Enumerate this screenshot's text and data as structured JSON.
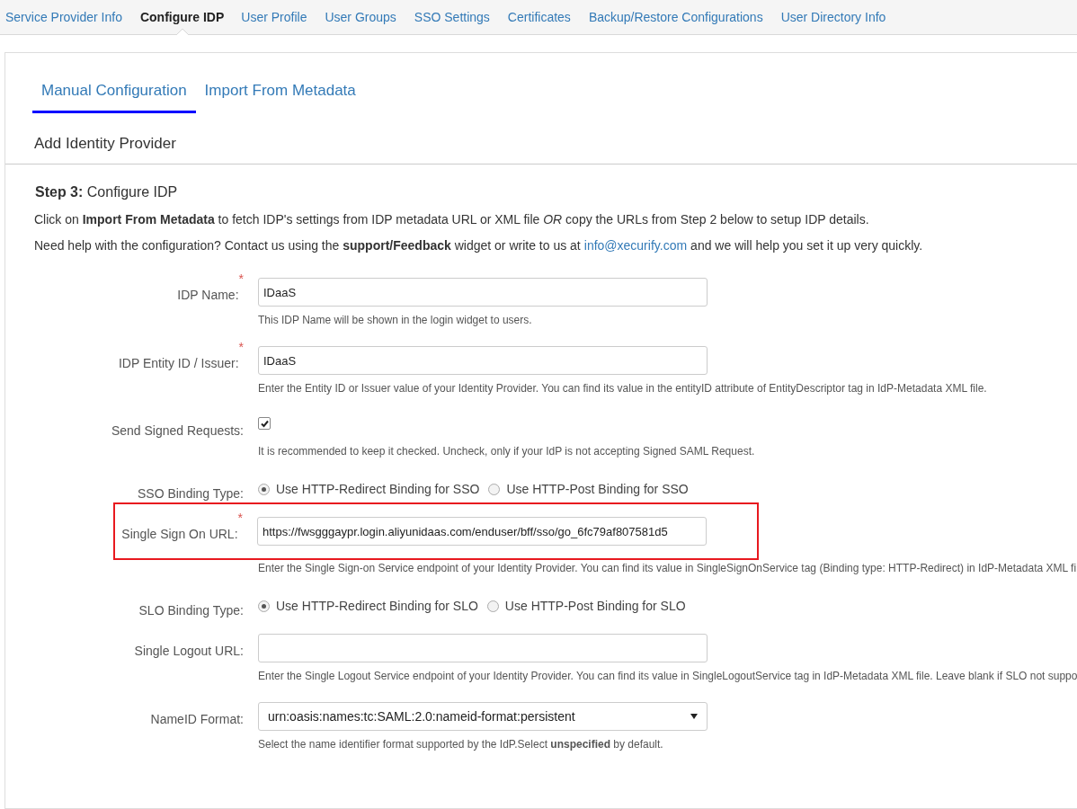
{
  "nav": {
    "items": [
      {
        "label": "Service Provider Info",
        "selected": false
      },
      {
        "label": "Configure IDP",
        "selected": true
      },
      {
        "label": "User Profile",
        "selected": false
      },
      {
        "label": "User Groups",
        "selected": false
      },
      {
        "label": "SSO Settings",
        "selected": false
      },
      {
        "label": "Certificates",
        "selected": false
      },
      {
        "label": "Backup/Restore Configurations",
        "selected": false
      },
      {
        "label": "User Directory Info",
        "selected": false
      }
    ]
  },
  "subtabs": [
    {
      "label": "Manual Configuration",
      "selected": true
    },
    {
      "label": "Import From Metadata",
      "selected": false
    }
  ],
  "section_title": "Add Identity Provider",
  "step_heading": "**Step 3:** Configure IDP",
  "intro": "Click on **Import From Metadata** to fetch IDP's settings from IDP metadata URL or XML file *OR* copy the URLs from Step 2 below to setup IDP details.",
  "help": {
    "before": "Need help with the configuration? Contact us using the **support/Feedback** widget or write to us at",
    "link": "info@xecurify.com",
    "after": "and we will help you set it up very quickly."
  },
  "fields": [
    {
      "kind": "text",
      "label": "IDP Name:",
      "mark": "*",
      "value": "IDaaS",
      "hint": "This IDP Name will be shown in the login widget to users.",
      "highlighted": false
    },
    {
      "kind": "text",
      "label": "IDP Entity ID / Issuer:",
      "mark": "*",
      "value": "IDaaS",
      "hint": "Enter the Entity ID or Issuer value of your Identity Provider. You can find its value in the entityID attribute of EntityDescriptor tag in IdP-Metadata XML file.",
      "highlighted": false
    },
    {
      "kind": "checkbox",
      "label": "Send Signed Requests:",
      "checked": true,
      "hint": "It is recommended to keep it checked. Uncheck, only if your IdP is not accepting Signed SAML Request.",
      "highlighted": false
    },
    {
      "kind": "radio",
      "label": "SSO Binding Type:",
      "options": [
        {
          "label": "Use HTTP-Redirect Binding for SSO",
          "selected": true
        },
        {
          "label": "Use HTTP-Post Binding for SSO",
          "selected": false
        }
      ],
      "highlighted": false
    },
    {
      "kind": "text",
      "label": "Single Sign On URL:",
      "mark": "*",
      "value": "https://fwsgggaypr.login.aliyunidaas.com/enduser/bff/sso/go_6fc79af807581d5",
      "hint": "Enter the Single Sign-on Service endpoint of your Identity Provider. You can find its value in SingleSignOnService tag (Binding type: HTTP-Redirect) in IdP-Metadata XML fi",
      "highlighted": true
    },
    {
      "kind": "radio",
      "label": "SLO Binding Type:",
      "options": [
        {
          "label": "Use HTTP-Redirect Binding for SLO",
          "selected": true
        },
        {
          "label": "Use HTTP-Post Binding for SLO",
          "selected": false
        }
      ],
      "highlighted": false
    },
    {
      "kind": "text",
      "label": "Single Logout URL:",
      "hint": "Enter the Single Logout Service endpoint of your Identity Provider. You can find its value in SingleLogoutService tag in IdP-Metadata XML file. Leave blank if SLO not suppo",
      "highlighted": false
    },
    {
      "kind": "select",
      "label": "NameID Format:",
      "value": "urn:oasis:names:tc:SAML:2.0:nameid-format:persistent",
      "hint": "Select the name identifier format supported by the IdP.Select **unspecified** by default.",
      "highlighted": false
    }
  ]
}
